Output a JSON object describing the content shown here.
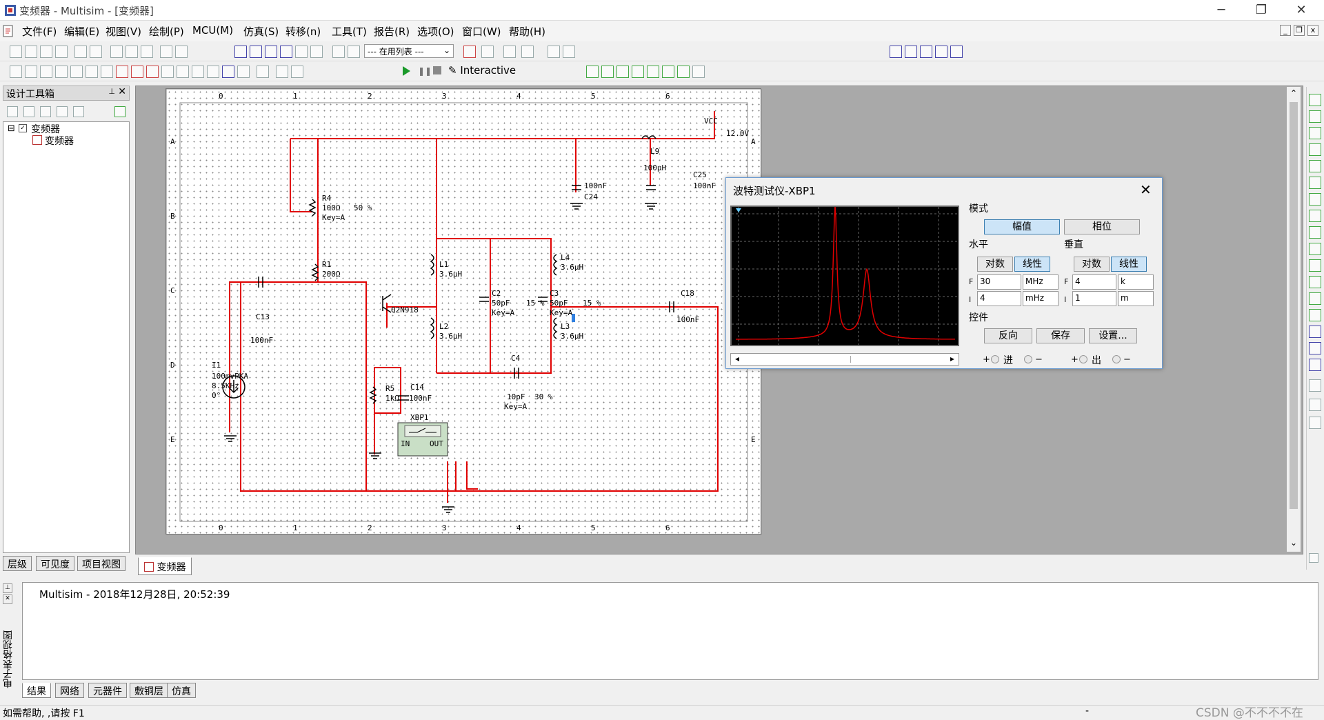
{
  "window": {
    "title": "变频器 - Multisim - [变频器]",
    "controls": [
      "─",
      "❐",
      "✕"
    ]
  },
  "menu": {
    "items": [
      "文件(F)",
      "编辑(E)",
      "视图(V)",
      "绘制(P)",
      "MCU(M)",
      "仿真(S)",
      "转移(n)",
      "工具(T)",
      "报告(R)",
      "选项(O)",
      "窗口(W)",
      "帮助(H)"
    ],
    "mdi_controls": [
      "_",
      "❐",
      "x"
    ]
  },
  "toolbar": {
    "in_use_list": "--- 在用列表 ---",
    "interactive": "Interactive"
  },
  "design_toolbox": {
    "title": "设计工具箱",
    "tree_root": "变频器",
    "tree_child": "变频器",
    "tabs": [
      "层级",
      "可见度",
      "项目视图"
    ]
  },
  "sheet": {
    "tab": "变频器",
    "col_labels": [
      "0",
      "1",
      "2",
      "3",
      "4",
      "5",
      "6"
    ],
    "row_labels": [
      "A",
      "B",
      "C",
      "D",
      "E"
    ],
    "components": {
      "vcc": "VCC",
      "vcc_val": "12.0V",
      "l9": "L9",
      "l9_val": "100μH",
      "c24": "C24",
      "c24_val": "100nF",
      "c25": "C25",
      "c25_val": "100nF",
      "r4": "R4",
      "r4_val": "100Ω",
      "r4_key": "Key=A",
      "r4_pct": "50 %",
      "r1": "R1",
      "r1_val": "200Ω",
      "l1": "L1",
      "l1_val": "3.6μH",
      "l2": "L2",
      "l2_val": "3.6μH",
      "l3": "L3",
      "l3_val": "3.6μH",
      "l4": "L4",
      "l4_val": "3.6μH",
      "c2": "C2",
      "c2_val": "50pF",
      "c2_key": "Key=A",
      "c2_pct": "15 %",
      "c3": "C3",
      "c3_val": "50pF",
      "c3_key": "Key=A",
      "c3_pct": "15 %",
      "c4": "C4",
      "c4_val": "10pF",
      "c4_key": "Key=A",
      "c4_pct": "30 %",
      "c18": "C18",
      "c18_val": "100nF",
      "c13": "C13",
      "c13_val": "100nF",
      "q": "Q2N918",
      "c14": "C14",
      "c14_val": "100nF",
      "r5": "R5",
      "r5_val": "1kΩ",
      "i1": "I1",
      "i1_val1": "100mvPKA",
      "i1_val2": "8.5KHz",
      "i1_val3": "0°",
      "xbp": "XBP1",
      "xbp_in": "IN",
      "xbp_out": "OUT"
    }
  },
  "bode": {
    "title": "波特测试仪-XBP1",
    "mode_label": "模式",
    "mode_mag": "幅值",
    "mode_phase": "相位",
    "horizontal": "水平",
    "vertical": "垂直",
    "log": "对数",
    "lin": "线性",
    "f": "F",
    "i": "I",
    "h_f_value": "30",
    "h_f_unit": "MHz",
    "h_i_value": "4",
    "h_i_unit": "mHz",
    "v_f_value": "4",
    "v_f_unit": "k",
    "v_i_value": "1",
    "v_i_unit": "m",
    "controls": "控件",
    "reverse": "反向",
    "save": "保存",
    "settings": "设置...",
    "in": "进",
    "out": "出",
    "plus": "+",
    "minus": "−",
    "trace_color": "#e00000"
  },
  "output": {
    "side_label": "电子表格视图",
    "log": "Multisim  -  2018年12月28日, 20:52:39",
    "tabs": [
      "结果",
      "网络",
      "元器件",
      "敷铜层",
      "仿真"
    ]
  },
  "status": {
    "help": "如需帮助, ,请按 F1",
    "dash": "-",
    "watermark": "CSDN @不不不不在"
  }
}
